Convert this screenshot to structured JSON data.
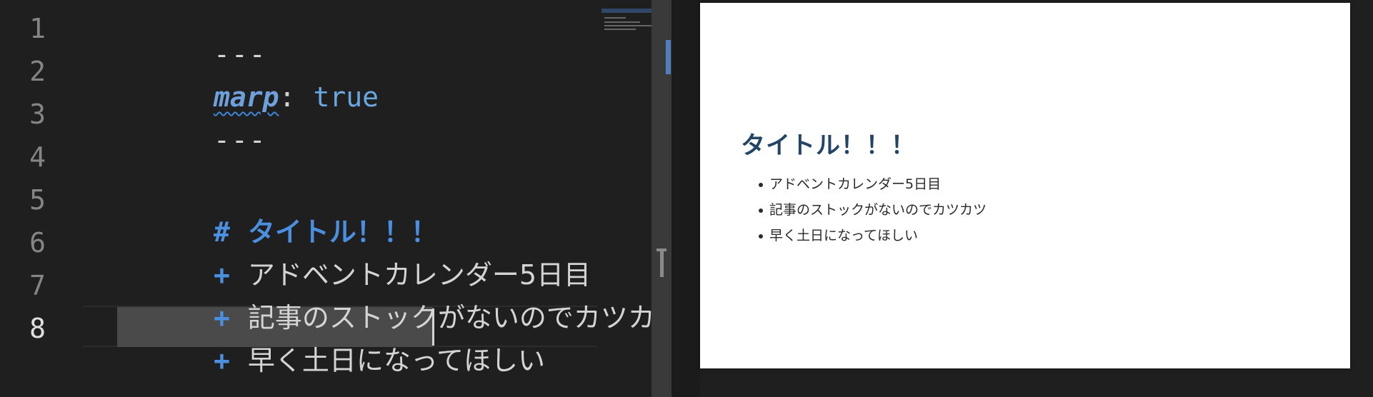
{
  "editor": {
    "top_peek": "~ ~ ~ ~",
    "line_numbers": [
      "1",
      "2",
      "3",
      "4",
      "5",
      "6",
      "7",
      "8"
    ],
    "active_line": "8",
    "lines": {
      "l1": "---",
      "l2_key": "marp",
      "l2_colon": ":",
      "l2_value": "true",
      "l3": "---",
      "l5_hash": "#",
      "l5_text": "タイトル！！！",
      "l6_marker": "+",
      "l6_text": "アドベントカレンダー5日目",
      "l7_marker": "+",
      "l7_text": "記事のストックがないのでカツカツ",
      "l8_marker": "+",
      "l8_text": "早く土日になってほしい"
    },
    "colors": {
      "keyword": "#4a8fe0",
      "yaml_key": "#6ea0dc",
      "selection": "#4a4a4a"
    }
  },
  "preview": {
    "title": "タイトル！！！",
    "items": [
      "アドベントカレンダー5日目",
      "記事のストックがないのでカツカツ",
      "早く土日になってほしい"
    ],
    "title_color": "#224466"
  }
}
